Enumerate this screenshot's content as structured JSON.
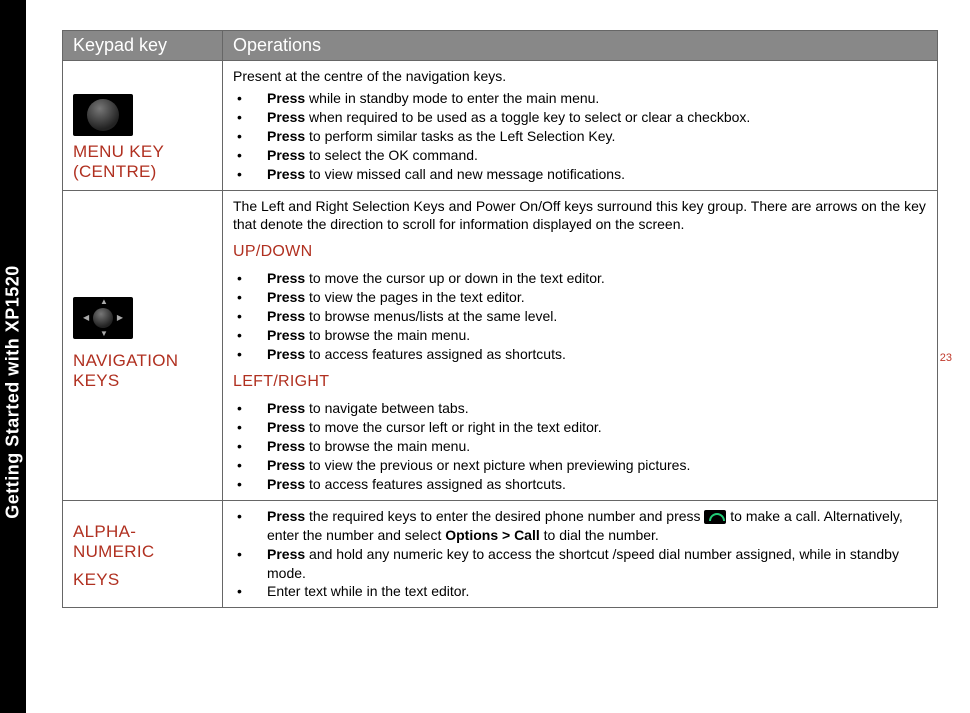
{
  "sidebar": {
    "label": "Getting Started with XP1520"
  },
  "page_number": "23",
  "table": {
    "headers": {
      "col1": "Keypad key",
      "col2": "Operations"
    },
    "row1": {
      "keyname": "MENU KEY (CENTRE)",
      "desc": "Present at the centre of the navigation keys.",
      "items": [
        {
          "b": "Press",
          "t": " while in standby mode to enter the main menu."
        },
        {
          "b": "Press",
          "t": " when required to be used as a toggle key to select or clear a checkbox."
        },
        {
          "b": "Press",
          "t": " to perform similar tasks as the Left Selection Key."
        },
        {
          "b": "Press",
          "t": " to select the OK command."
        },
        {
          "b": "Press",
          "t": " to view missed call and new message notifications."
        }
      ]
    },
    "row2": {
      "keyname": "NAVIGATION KEYS",
      "desc": "The Left and Right Selection Keys and Power On/Off keys surround this key group. There are arrows on the key that denote the direction to scroll for information displayed on the screen.",
      "sub1": "UP/DOWN",
      "items1": [
        {
          "b": "Press",
          "t": " to move the cursor up or down in the text editor."
        },
        {
          "b": "Press",
          "t": " to view the pages in the text editor."
        },
        {
          "b": "Press",
          "t": " to browse menus/lists at the same level."
        },
        {
          "b": "Press",
          "t": " to browse the main menu."
        },
        {
          "b": "Press",
          "t": " to access features assigned as shortcuts."
        }
      ],
      "sub2": "LEFT/RIGHT",
      "items2": [
        {
          "b": "Press",
          "t": " to navigate between tabs."
        },
        {
          "b": "Press",
          "t": " to move the cursor left or right in the text editor."
        },
        {
          "b": "Press",
          "t": " to browse the main menu."
        },
        {
          "b": "Press",
          "t": " to view the previous or next picture when previewing pictures."
        },
        {
          "b": "Press",
          "t": " to access features assigned as shortcuts."
        }
      ]
    },
    "row3": {
      "keyname1": "ALPHA-NUMERIC",
      "keyname2": "KEYS",
      "item1_b1": "Press",
      "item1_t1": " the required keys to enter the desired phone number and press ",
      "item1_t2": " to make a call. Alternatively, enter the number and select ",
      "item1_b2": "Options > Call",
      "item1_t3": " to dial the number.",
      "item2_b": "Press",
      "item2_t": " and hold any numeric key to access the shortcut /speed dial number assigned, while in standby mode.",
      "item3_t": "Enter text while in the text editor."
    }
  }
}
